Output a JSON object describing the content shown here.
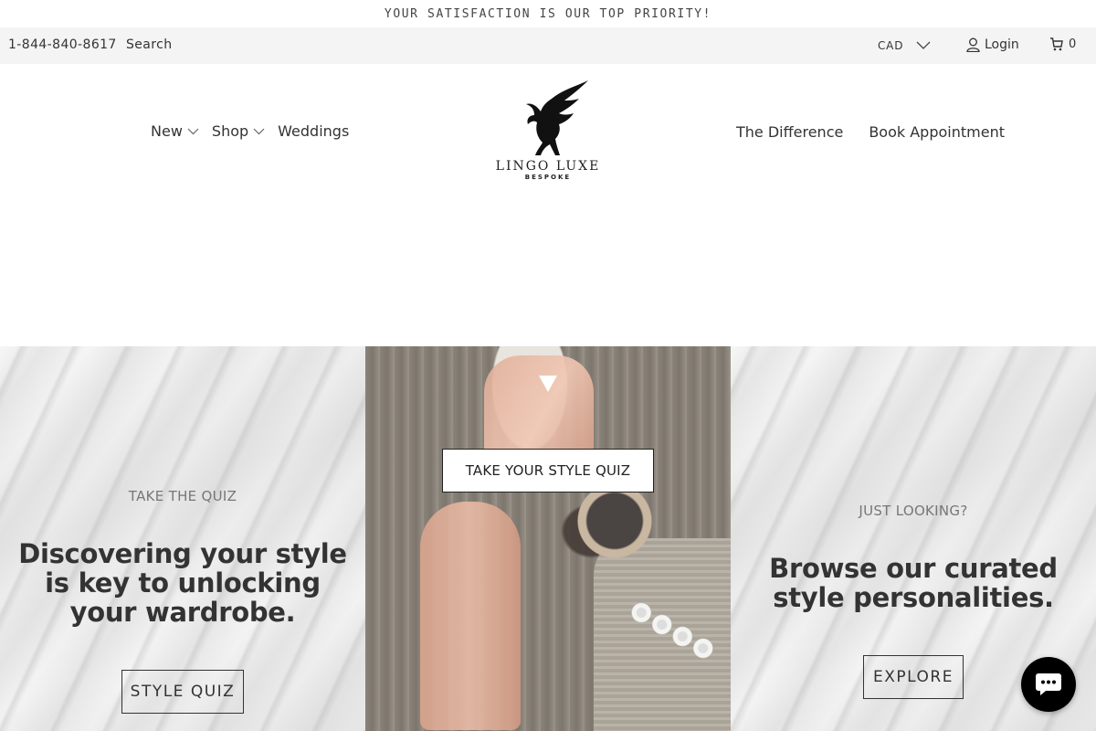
{
  "announcement": {
    "text": "YOUR SATISFACTION IS OUR TOP PRIORITY!"
  },
  "utility_bar": {
    "phone": "1-844-840-8617",
    "search_label": "Search",
    "currency": "CAD",
    "login_label": "Login",
    "cart_count": "0"
  },
  "nav_left": [
    {
      "label": "New",
      "has_dropdown": true
    },
    {
      "label": "Shop",
      "has_dropdown": true
    },
    {
      "label": "Weddings",
      "has_dropdown": false
    }
  ],
  "nav_right": [
    {
      "label": "The Difference"
    },
    {
      "label": "Book Appointment"
    }
  ],
  "logo": {
    "name": "LINGO LUXE",
    "sub": "BESPOKE",
    "icon": "pegasus-icon"
  },
  "promo_left": {
    "kicker": "TAKE THE QUIZ",
    "headline": "Discovering your style is key to unlocking your wardrobe.",
    "button_label": "STYLE QUIZ"
  },
  "promo_middle": {
    "button_label": "TAKE YOUR STYLE QUIZ"
  },
  "promo_right": {
    "kicker": "JUST LOOKING?",
    "headline": "Browse our curated style personalities.",
    "button_label": "EXPLORE"
  },
  "chat": {
    "icon": "chat-bubble-icon"
  },
  "colors": {
    "text": "#333333",
    "utility_bg": "#f4f4f4",
    "chat_bg": "#000000"
  }
}
